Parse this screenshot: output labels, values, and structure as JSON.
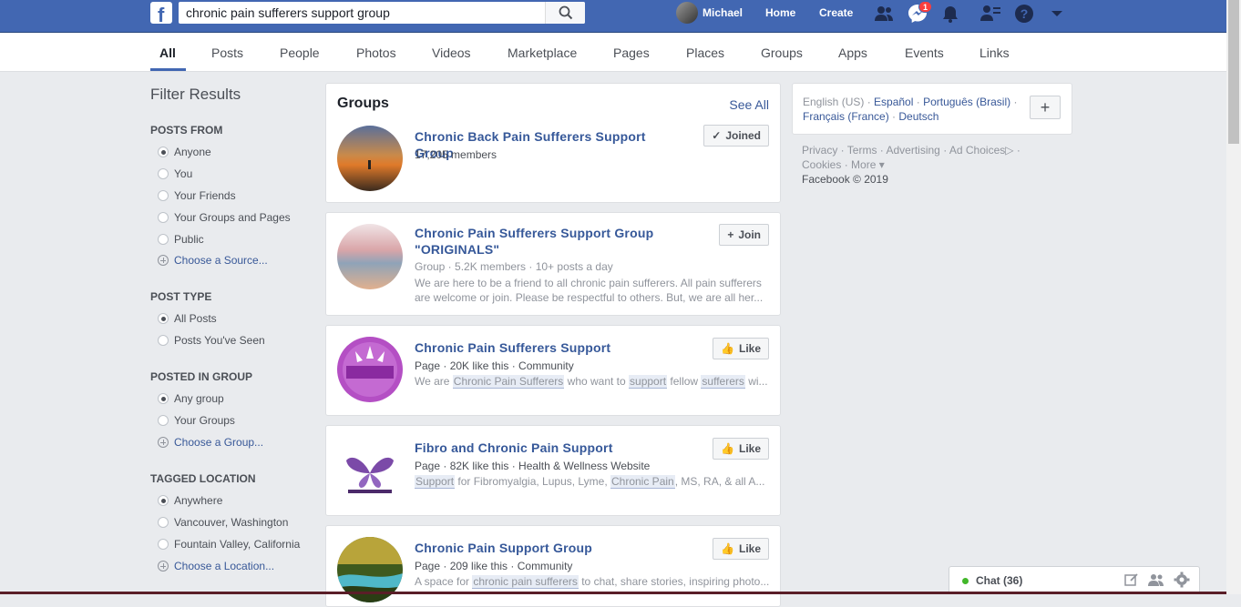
{
  "topbar": {
    "logo": "f",
    "search_value": "chronic pain sufferers support group",
    "user_name": "Michael",
    "home": "Home",
    "create": "Create",
    "messenger_badge": "1"
  },
  "tabs": [
    "All",
    "Posts",
    "People",
    "Photos",
    "Videos",
    "Marketplace",
    "Pages",
    "Places",
    "Groups",
    "Apps",
    "Events",
    "Links"
  ],
  "filter": {
    "title": "Filter Results",
    "sections": [
      {
        "heading": "POSTS FROM",
        "options": [
          "Anyone",
          "You",
          "Your Friends",
          "Your Groups and Pages",
          "Public"
        ],
        "selected": 0,
        "link": "Choose a Source..."
      },
      {
        "heading": "POST TYPE",
        "options": [
          "All Posts",
          "Posts You've Seen"
        ],
        "selected": 0,
        "link": ""
      },
      {
        "heading": "POSTED IN GROUP",
        "options": [
          "Any group",
          "Your Groups"
        ],
        "selected": 0,
        "link": "Choose a Group..."
      },
      {
        "heading": "TAGGED LOCATION",
        "options": [
          "Anywhere",
          "Vancouver, Washington",
          "Fountain Valley, California"
        ],
        "selected": 0,
        "link": "Choose a Location..."
      }
    ]
  },
  "groups_card": {
    "heading": "Groups",
    "see_all": "See All"
  },
  "results": [
    {
      "title": "Chronic Back Pain Sufferers Support Group",
      "meta": "17,205 members",
      "desc": "",
      "button": "Joined"
    },
    {
      "title": "Chronic Pain Sufferers Support Group \"ORIGINALS\"",
      "meta": "Group · 5.2K members · 10+ posts a day",
      "desc": "We are here to be a friend to all chronic pain sufferers. All pain sufferers are welcome or join. Please be respectful to others. But, we are all her...",
      "button": "Join"
    },
    {
      "title": "Chronic Pain Sufferers Support",
      "meta": "Page · 20K like this · Community",
      "desc_parts": [
        "We are ",
        "Chronic Pain Sufferers",
        " who want to ",
        "support",
        " fellow ",
        "sufferers",
        " wi..."
      ],
      "button": "Like"
    },
    {
      "title": "Fibro and Chronic Pain Support",
      "meta": "Page · 82K like this · Health & Wellness Website",
      "desc_parts": [
        "",
        "Support",
        " for Fibromyalgia, Lupus, Lyme, ",
        "Chronic Pain",
        ", MS, RA, & all A..."
      ],
      "button": "Like"
    },
    {
      "title": "Chronic Pain Support Group",
      "meta": "Page · 209 like this · Community",
      "desc_parts": [
        "A space for ",
        "chronic pain sufferers",
        " to chat, share stories, inspiring photo..."
      ],
      "button": "Like"
    }
  ],
  "right": {
    "langs": [
      "English (US)",
      "Español",
      "Português (Brasil)",
      "Français (France)",
      "Deutsch"
    ],
    "add_lang": "+",
    "footer_links": [
      "Privacy",
      "Terms",
      "Advertising",
      "Ad Choices",
      "Cookies",
      "More"
    ],
    "copyright": "Facebook © 2019"
  },
  "chat": {
    "label": "Chat (36)"
  },
  "colors": {
    "brand": "#4267b2",
    "link": "#365899",
    "online": "#42b72a"
  }
}
